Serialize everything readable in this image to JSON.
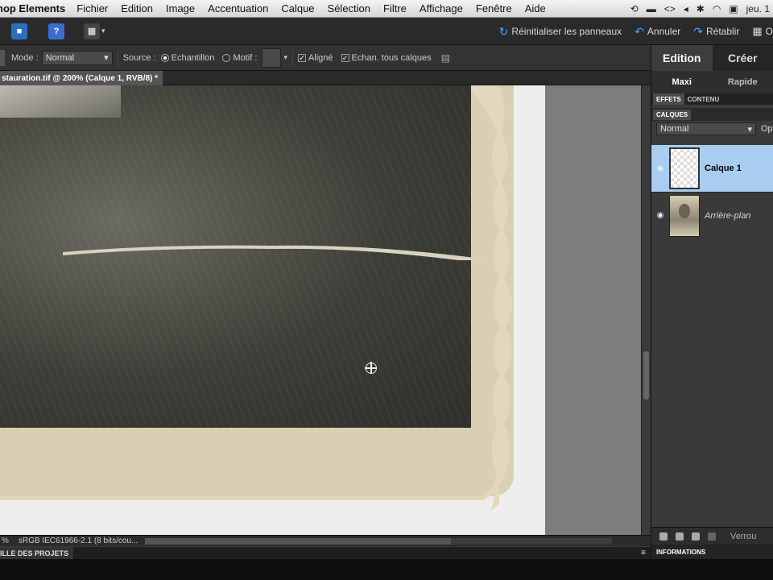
{
  "menubar": {
    "app_name": "hop Elements",
    "items": [
      "Fichier",
      "Edition",
      "Image",
      "Accentuation",
      "Calque",
      "Sélection",
      "Filtre",
      "Affichage",
      "Fenêtre",
      "Aide"
    ],
    "clock": "jeu. 1"
  },
  "appbar": {
    "reset_panels_label": "Réinitialiser les panneaux",
    "undo_label": "Annuler",
    "redo_label": "Rétablir",
    "organizer_label": "O"
  },
  "options": {
    "mode_label": "Mode :",
    "mode_value": "Normal",
    "source_label": "Source :",
    "source_sample_label": "Echantillon",
    "source_pattern_label": "Motif :",
    "aligned_label": "Aligné",
    "sample_all_label": "Echan. tous calques"
  },
  "document": {
    "tab_title": "stauration.tif @ 200% (Calque 1, RVB/8) *"
  },
  "status": {
    "zoom": "%",
    "profile": "sRGB IEC61966-2.1 (8 bits/cou..."
  },
  "project_bin": {
    "label": "ILLE DES PROJETS"
  },
  "panel": {
    "modes": [
      "Edition",
      "Créer"
    ],
    "submodes": [
      "Maxi",
      "Rapide"
    ],
    "tabs": [
      "EFFETS",
      "CONTENU"
    ],
    "layers_title": "CALQUES",
    "blend_mode": "Normal",
    "opacity_label": "Op",
    "layers": [
      {
        "name": "Calque 1"
      },
      {
        "name": "Arrière-plan"
      }
    ],
    "lock_label": "Verrou",
    "info_title": "INFORMATIONS"
  },
  "colors": {
    "accent": "#4aa3ff",
    "selected_layer": "#a9cdf0"
  }
}
